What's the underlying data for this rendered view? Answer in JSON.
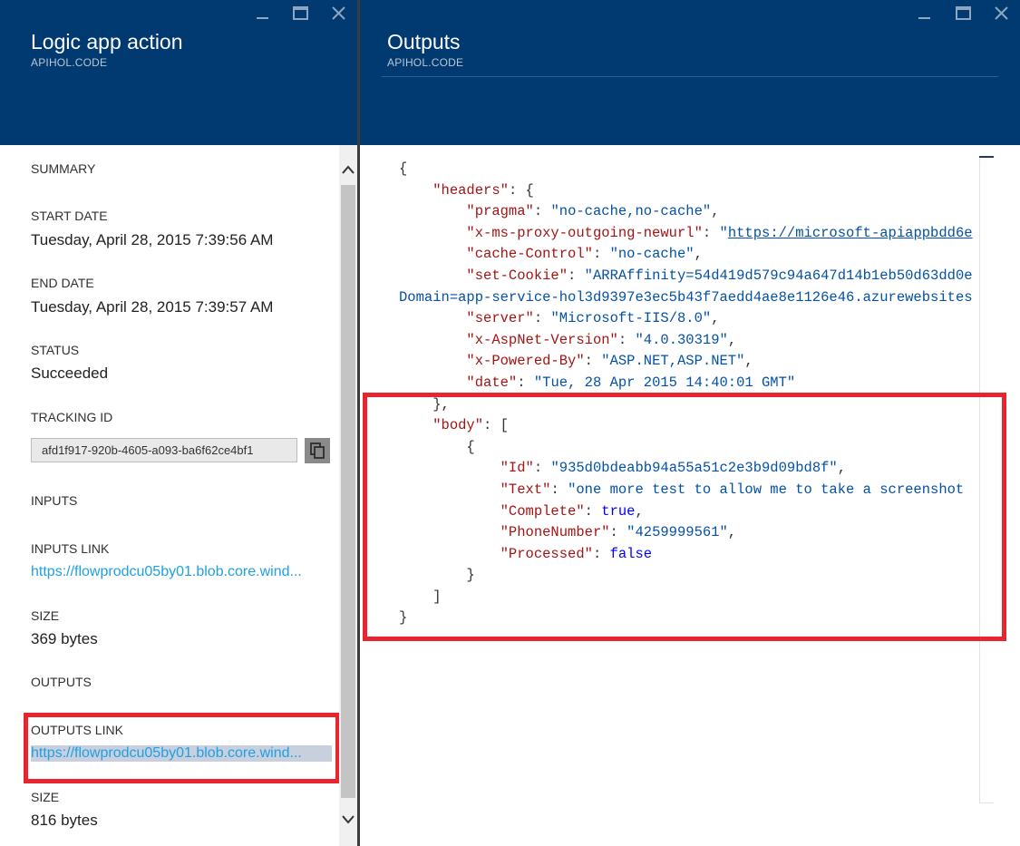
{
  "left_blade": {
    "title": "Logic app action",
    "subtitle": "APIHOL.CODE",
    "summary_label": "SUMMARY",
    "start_date": {
      "label": "START DATE",
      "value": "Tuesday, April 28, 2015 7:39:56 AM"
    },
    "end_date": {
      "label": "END DATE",
      "value": "Tuesday, April 28, 2015 7:39:57 AM"
    },
    "status": {
      "label": "STATUS",
      "value": "Succeeded"
    },
    "tracking_id": {
      "label": "TRACKING ID",
      "value": "afd1f917-920b-4605-a093-ba6f62ce4bf1"
    },
    "inputs_label": "INPUTS",
    "inputs_link": {
      "label": "INPUTS LINK",
      "value": "https://flowprodcu05by01.blob.core.wind..."
    },
    "inputs_size": {
      "label": "SIZE",
      "value": "369 bytes"
    },
    "outputs_label": "OUTPUTS",
    "outputs_link": {
      "label": "OUTPUTS LINK",
      "value": "https://flowprodcu05by01.blob.core.wind..."
    },
    "outputs_size": {
      "label": "SIZE",
      "value": "816 bytes"
    }
  },
  "right_blade": {
    "title": "Outputs",
    "subtitle": "APIHOL.CODE",
    "json_lines": [
      "{",
      "    \"headers\": {",
      "        \"pragma\": \"no-cache,no-cache\",",
      "        \"x-ms-proxy-outgoing-newurl\": \"https://microsoft-apiappbdd6e",
      "        \"cache-Control\": \"no-cache\",",
      "        \"set-Cookie\": \"ARRAffinity=54d419d579c94a647d14b1eb50d63dd0e",
      "Domain=app-service-hol3d9397e3ec5b43f7aedd4ae8e1126e46.azurewebsites",
      "        \"server\": \"Microsoft-IIS/8.0\",",
      "        \"x-AspNet-Version\": \"4.0.30319\",",
      "        \"x-Powered-By\": \"ASP.NET,ASP.NET\",",
      "        \"date\": \"Tue, 28 Apr 2015 14:40:01 GMT\"",
      "    },",
      "    \"body\": [",
      "        {",
      "            \"Id\": \"935d0bdeabb94a55a51c2e3b9d09bd8f\",",
      "            \"Text\": \"one more test to allow me to take a screenshot",
      "            \"Complete\": true,",
      "            \"PhoneNumber\": \"4259999561\",",
      "            \"Processed\": false",
      "        }",
      "    ]",
      "}"
    ]
  },
  "colors": {
    "header_bg": "#003a70",
    "link": "#1ea0e6",
    "highlight_box": "#e8242e",
    "json_key": "#a31515",
    "json_string": "#0451a5",
    "json_literal": "#0000ff"
  },
  "icons": [
    "minimize-icon",
    "maximize-icon",
    "close-icon",
    "copy-icon",
    "scroll-up-icon",
    "scroll-down-icon"
  ]
}
